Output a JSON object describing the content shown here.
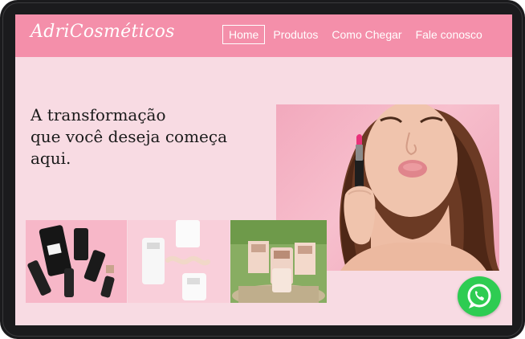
{
  "brand": {
    "name": "AdriCosméticos"
  },
  "nav": {
    "items": [
      {
        "label": "Home",
        "active": true
      },
      {
        "label": "Produtos",
        "active": false
      },
      {
        "label": "Como Chegar",
        "active": false
      },
      {
        "label": "Fale conosco",
        "active": false
      }
    ]
  },
  "hero": {
    "lines": [
      "A transformação",
      "que você deseja começa",
      "aqui."
    ]
  },
  "icons": {
    "whatsapp": "whatsapp-icon"
  },
  "colors": {
    "navbar": "#f48faa",
    "page_background": "#f8dbe3",
    "whatsapp_green": "#2ecc52",
    "text": "#1a1a1a"
  }
}
